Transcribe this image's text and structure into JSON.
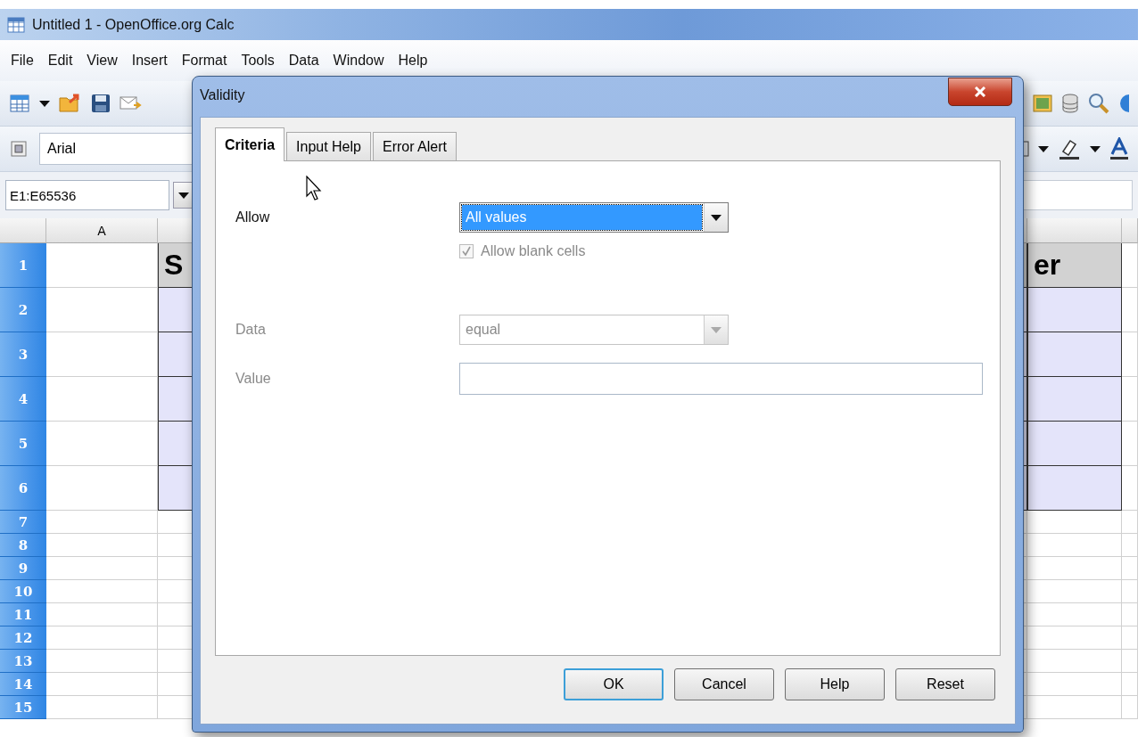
{
  "window": {
    "title": "Untitled 1 - OpenOffice.org Calc"
  },
  "menu": [
    "File",
    "Edit",
    "View",
    "Insert",
    "Format",
    "Tools",
    "Data",
    "Window",
    "Help"
  ],
  "font_box": {
    "value": "Arial"
  },
  "name_box": {
    "value": "E1:E65536"
  },
  "sheet": {
    "columns": [
      "A"
    ],
    "rows": [
      "1",
      "2",
      "3",
      "4",
      "5",
      "6",
      "7",
      "8",
      "9",
      "10",
      "11",
      "12",
      "13",
      "14",
      "15"
    ],
    "row1_fragments": [
      "S",
      "er"
    ]
  },
  "dialog": {
    "title": "Validity",
    "tabs": [
      {
        "label": "Criteria",
        "selected": true
      },
      {
        "label": "Input Help",
        "selected": false
      },
      {
        "label": "Error Alert",
        "selected": false
      }
    ],
    "allow": {
      "label": "Allow",
      "value": "All values"
    },
    "allow_blank": {
      "label": "Allow blank cells",
      "checked": true,
      "disabled": true
    },
    "data": {
      "label": "Data",
      "value": "equal",
      "disabled": true
    },
    "value_field": {
      "label": "Value",
      "disabled": true
    },
    "buttons": [
      {
        "label": "OK",
        "default": true
      },
      {
        "label": "Cancel",
        "default": false
      },
      {
        "label": "Help",
        "default": false
      },
      {
        "label": "Reset",
        "default": false
      }
    ]
  }
}
